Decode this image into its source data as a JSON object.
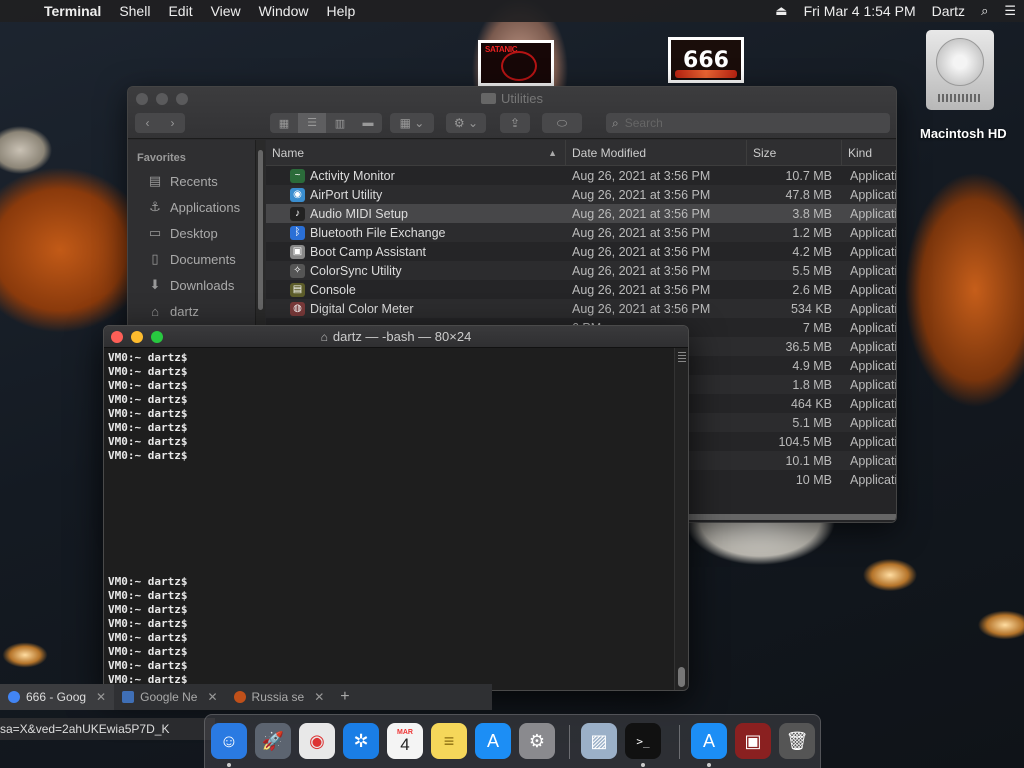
{
  "menubar": {
    "apple": "",
    "app_name": "Terminal",
    "items": [
      "Shell",
      "Edit",
      "View",
      "Window",
      "Help"
    ],
    "eject": "⏏",
    "datetime": "Fri Mar 4  1:54 PM",
    "user": "Dartz",
    "search_icon": "⌕",
    "list_icon": "☰"
  },
  "desktop": {
    "thumb1_text": "SATANIC",
    "thumb2_text": "666",
    "hd_label": "Macintosh HD"
  },
  "finder": {
    "title": "Utilities",
    "nav_back": "‹",
    "nav_forward": "›",
    "view_icons": [
      "▦",
      "☰",
      "▥",
      "▬"
    ],
    "group_icon": "▦ ⌄",
    "action_icon": "⚙ ⌄",
    "share_icon": "⇪",
    "tag_icon": "⬭",
    "search_placeholder": "Search",
    "sidebar": {
      "header": "Favorites",
      "items": [
        {
          "label": "Recents",
          "icon": "▤"
        },
        {
          "label": "Applications",
          "icon": "⚓"
        },
        {
          "label": "Desktop",
          "icon": "▭"
        },
        {
          "label": "Documents",
          "icon": "▯"
        },
        {
          "label": "Downloads",
          "icon": "⬇"
        },
        {
          "label": "dartz",
          "icon": "⌂"
        }
      ]
    },
    "columns": {
      "name": "Name",
      "date": "Date Modified",
      "size": "Size",
      "kind": "Kind",
      "sort_arrow": "▲"
    },
    "rows": [
      {
        "name": "Activity Monitor",
        "date": "Aug 26, 2021 at 3:56 PM",
        "size": "10.7 MB",
        "kind": "Application",
        "icon_color": "#2b6b3a",
        "icon": "~"
      },
      {
        "name": "AirPort Utility",
        "date": "Aug 26, 2021 at 3:56 PM",
        "size": "47.8 MB",
        "kind": "Application",
        "icon_color": "#3a8ed0",
        "icon": "◉"
      },
      {
        "name": "Audio MIDI Setup",
        "date": "Aug 26, 2021 at 3:56 PM",
        "size": "3.8 MB",
        "kind": "Application",
        "icon_color": "#222",
        "icon": "♪"
      },
      {
        "name": "Bluetooth File Exchange",
        "date": "Aug 26, 2021 at 3:56 PM",
        "size": "1.2 MB",
        "kind": "Application",
        "icon_color": "#2a6fd6",
        "icon": "ᛒ"
      },
      {
        "name": "Boot Camp Assistant",
        "date": "Aug 26, 2021 at 3:56 PM",
        "size": "4.2 MB",
        "kind": "Application",
        "icon_color": "#888",
        "icon": "▣"
      },
      {
        "name": "ColorSync Utility",
        "date": "Aug 26, 2021 at 3:56 PM",
        "size": "5.5 MB",
        "kind": "Application",
        "icon_color": "#555",
        "icon": "✧"
      },
      {
        "name": "Console",
        "date": "Aug 26, 2021 at 3:56 PM",
        "size": "2.6 MB",
        "kind": "Application",
        "icon_color": "#5d5d2a",
        "icon": "▤"
      },
      {
        "name": "Digital Color Meter",
        "date": "Aug 26, 2021 at 3:56 PM",
        "size": "534 KB",
        "kind": "Application",
        "icon_color": "#7a3a3a",
        "icon": "◍"
      },
      {
        "name": "",
        "date": "6 PM",
        "size": "7 MB",
        "kind": "Application",
        "icon_color": "transparent",
        "icon": ""
      },
      {
        "name": "",
        "date": "6 PM",
        "size": "36.5 MB",
        "kind": "Application",
        "icon_color": "transparent",
        "icon": ""
      },
      {
        "name": "",
        "date": "6 PM",
        "size": "4.9 MB",
        "kind": "Application",
        "icon_color": "transparent",
        "icon": ""
      },
      {
        "name": "",
        "date": "6 PM",
        "size": "1.8 MB",
        "kind": "Application",
        "icon_color": "transparent",
        "icon": ""
      },
      {
        "name": "",
        "date": "6 PM",
        "size": "464 KB",
        "kind": "Application",
        "icon_color": "transparent",
        "icon": ""
      },
      {
        "name": "",
        "date": "6 PM",
        "size": "5.1 MB",
        "kind": "Application",
        "icon_color": "transparent",
        "icon": ""
      },
      {
        "name": "",
        "date": "6 PM",
        "size": "104.5 MB",
        "kind": "Application",
        "icon_color": "transparent",
        "icon": ""
      },
      {
        "name": "",
        "date": "6 PM",
        "size": "10.1 MB",
        "kind": "Application",
        "icon_color": "transparent",
        "icon": ""
      },
      {
        "name": "",
        "date": "6 PM",
        "size": "10 MB",
        "kind": "Application",
        "icon_color": "transparent",
        "icon": ""
      }
    ]
  },
  "terminal": {
    "title": "dartz — -bash — 80×24",
    "home_icon": "⌂",
    "lines": [
      "VM0:~ dartz$",
      "VM0:~ dartz$",
      "VM0:~ dartz$",
      "VM0:~ dartz$",
      "VM0:~ dartz$",
      "VM0:~ dartz$",
      "VM0:~ dartz$",
      "VM0:~ dartz$",
      "",
      "",
      "",
      "",
      "",
      "",
      "",
      "",
      "VM0:~ dartz$",
      "VM0:~ dartz$",
      "VM0:~ dartz$",
      "VM0:~ dartz$",
      "VM0:~ dartz$",
      "VM0:~ dartz$",
      "VM0:~ dartz$",
      "VM0:~ dartz$",
      "VM0:~ dartz$"
    ],
    "prompt_last": "VM0:~ dartz$ "
  },
  "browser": {
    "tabs": [
      {
        "label": "666 - Goog",
        "close": "✕",
        "color": "#4285f4"
      },
      {
        "label": "Google Ne",
        "close": "✕",
        "color": "#3f6fb6"
      },
      {
        "label": "Russia se",
        "close": "✕",
        "color": "#c0501a"
      }
    ],
    "new_tab": "+",
    "url": "sa=X&ved=2ahUKEwia5P7D_K"
  },
  "dock": {
    "items": [
      {
        "name": "finder",
        "glyph": "☺",
        "color": "#2a7ae2"
      },
      {
        "name": "launchpad",
        "glyph": "🚀",
        "color": "#5c6470"
      },
      {
        "name": "chrome",
        "glyph": "◉",
        "color": "#e8e8e8"
      },
      {
        "name": "safari",
        "glyph": "✲",
        "color": "#1a7ee6"
      },
      {
        "name": "calendar",
        "glyph": "4",
        "color": "#f4f4f4"
      },
      {
        "name": "notes",
        "glyph": "≡",
        "color": "#f5d75a"
      },
      {
        "name": "app-store",
        "glyph": "A",
        "color": "#1c8ef5"
      },
      {
        "name": "system-preferences",
        "glyph": "⚙",
        "color": "#8a8a8e"
      },
      {
        "name": "preview",
        "glyph": "▨",
        "color": "#9bb0c8"
      },
      {
        "name": "terminal",
        "glyph": ">_",
        "color": "#111"
      },
      {
        "name": "app-store-2",
        "glyph": "A",
        "color": "#1c8ef5"
      },
      {
        "name": "image-thumbnail",
        "glyph": "▣",
        "color": "#8a2020"
      },
      {
        "name": "trash",
        "glyph": "🗑",
        "color": "#555"
      }
    ],
    "calendar_month": "MAR"
  }
}
